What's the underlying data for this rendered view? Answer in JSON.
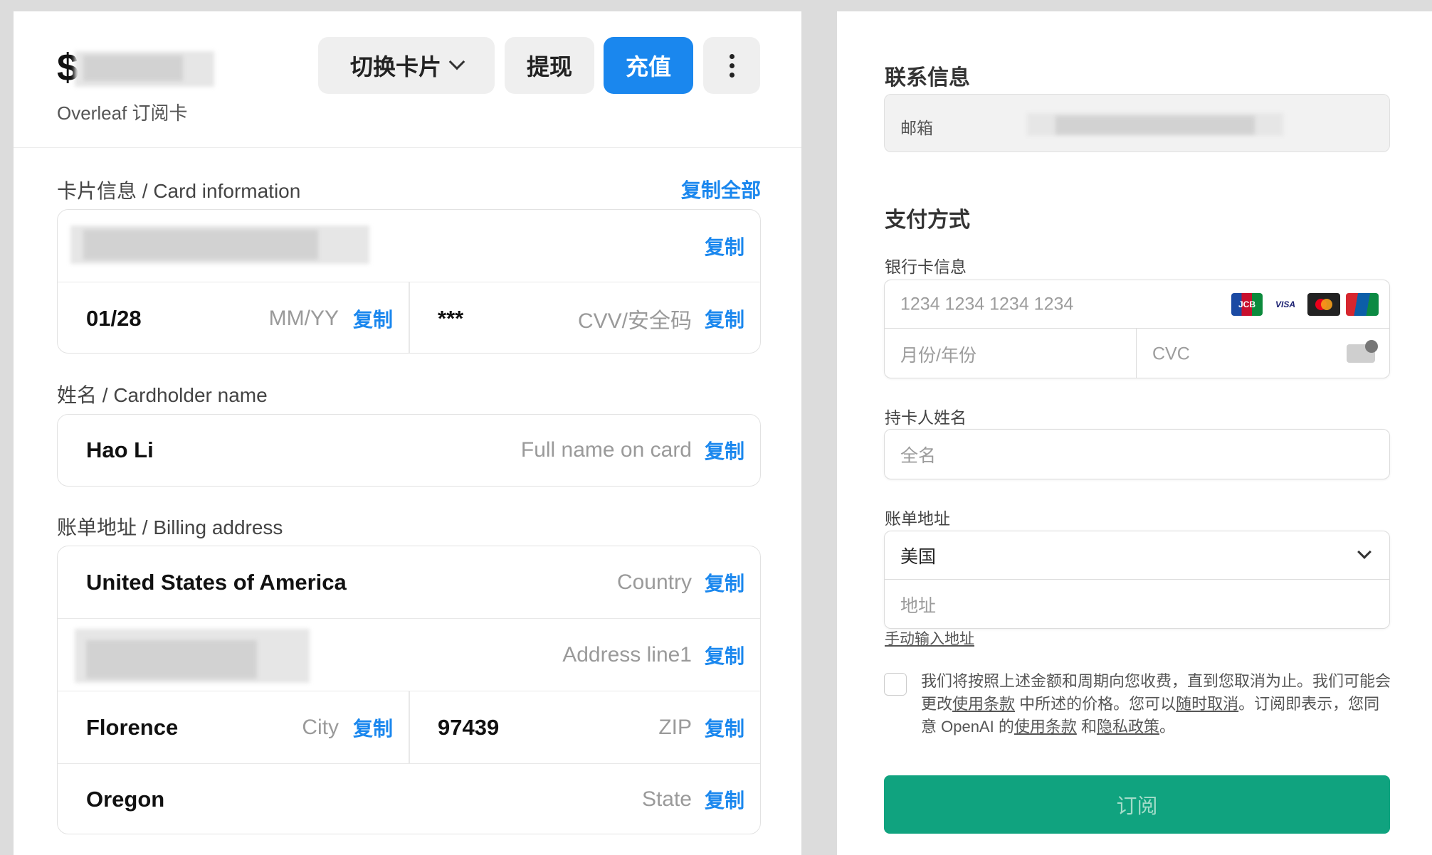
{
  "header": {
    "balance_symbol": "$",
    "card_name": "Overleaf 订阅卡",
    "switch_card_label": "切换卡片",
    "withdraw_label": "提现",
    "recharge_label": "充值"
  },
  "card_info": {
    "label": "卡片信息 / Card information",
    "copy_all": "复制全部",
    "copy": "复制",
    "expiry_value": "01/28",
    "expiry_hint": "MM/YY",
    "cvv_value": "***",
    "cvv_hint": "CVV/安全码"
  },
  "cardholder": {
    "label": "姓名 / Cardholder name",
    "value": "Hao Li",
    "hint": "Full name on card",
    "copy": "复制"
  },
  "billing": {
    "label": "账单地址 / Billing address",
    "country_value": "United States of America",
    "country_hint": "Country",
    "address_hint": "Address line1",
    "city_value": "Florence",
    "city_hint": "City",
    "zip_value": "97439",
    "zip_hint": "ZIP",
    "state_value": "Oregon",
    "state_hint": "State",
    "copy": "复制"
  },
  "checkout": {
    "contact_title": "联系信息",
    "email_label": "邮箱",
    "payment_title": "支付方式",
    "card_label": "银行卡信息",
    "card_number_placeholder": "1234 1234 1234 1234",
    "brands": [
      "JCB",
      "VISA",
      "Mastercard",
      "UnionPay"
    ],
    "expiry_placeholder": "月份/年份",
    "cvc_placeholder": "CVC",
    "name_label": "持卡人姓名",
    "name_placeholder": "全名",
    "address_label": "账单地址",
    "country_value": "美国",
    "address_placeholder": "地址",
    "manual_link": "手动输入地址",
    "terms_part1": "我们将按照上述金额和周期向您收费，直到您取消为止。我们可能会更改",
    "terms_link1": "使用条款",
    "terms_part2": " 中所述的价格。您可以",
    "terms_link2": "随时取消",
    "terms_part3": "。订阅即表示，您同意 OpenAI 的",
    "terms_link3": "使用条款",
    "terms_part4": " 和",
    "terms_link4": "隐私政策",
    "terms_part5": "。",
    "subscribe_label": "订阅"
  },
  "colors": {
    "accent_blue": "#1a87ee",
    "subscribe_green": "#10a37f"
  }
}
